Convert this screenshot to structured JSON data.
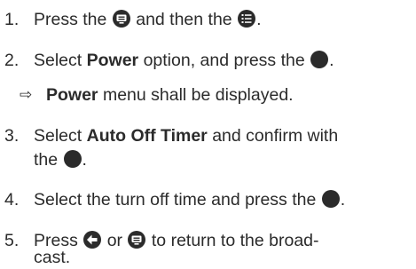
{
  "steps": [
    {
      "number": "1.",
      "text_a": "Press the",
      "icon_a": "menu-button-icon",
      "text_b": "and then the",
      "icon_b": "list-menu-icon",
      "text_c": "."
    },
    {
      "number": "2.",
      "text_a": "Select",
      "bold": "Power",
      "text_b": "option, and press the",
      "icon": "ok-button-icon",
      "text_c": "."
    },
    {
      "result_symbol": "⇨",
      "bold": "Power",
      "text": "menu shall be displayed."
    },
    {
      "number": "3.",
      "text_a": "Select",
      "bold": "Auto Off Timer",
      "text_b": "and confirm with",
      "text_c": "the",
      "icon": "ok-button-icon",
      "text_d": "."
    },
    {
      "number": "4.",
      "text_a": "Select the turn off time and press the",
      "icon": "ok-button-icon",
      "text_b": "."
    },
    {
      "number": "5.",
      "text_a": "Press",
      "icon_a": "back-arrow-icon",
      "text_b": "or",
      "icon_b": "menu-button-icon",
      "text_c": "to return to the broad-",
      "text_d": "cast."
    }
  ],
  "colors": {
    "text": "#2b2b2b",
    "icon": "#2b2b2b"
  }
}
